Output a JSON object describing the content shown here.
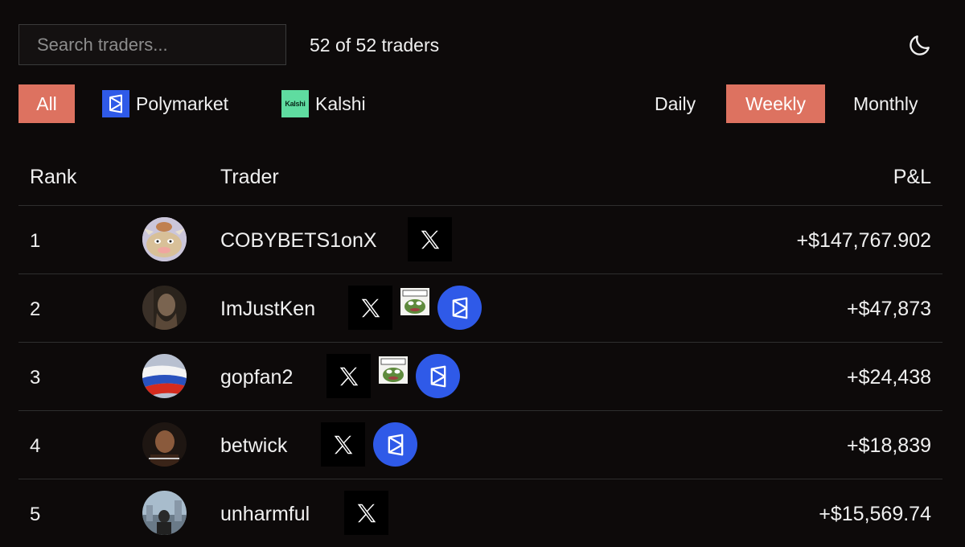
{
  "search": {
    "placeholder": "Search traders..."
  },
  "count_text": "52 of 52 traders",
  "platform_filters": {
    "all": "All",
    "polymarket": "Polymarket",
    "kalshi": "Kalshi",
    "kalshi_logo_text": "Kalshi"
  },
  "period_filters": {
    "daily": "Daily",
    "weekly": "Weekly",
    "monthly": "Monthly",
    "active": "Weekly"
  },
  "table": {
    "headers": {
      "rank": "Rank",
      "trader": "Trader",
      "pnl": "P&L"
    },
    "rows": [
      {
        "rank": "1",
        "name": "COBYBETS1onX",
        "pnl": "+$147,767.902",
        "badges": [
          "x-icon"
        ]
      },
      {
        "rank": "2",
        "name": "ImJustKen",
        "pnl": "+$47,873",
        "badges": [
          "x-icon",
          "pepe-icon",
          "polymarket-icon"
        ]
      },
      {
        "rank": "3",
        "name": "gopfan2",
        "pnl": "+$24,438",
        "badges": [
          "x-icon",
          "pepe-icon",
          "polymarket-icon"
        ]
      },
      {
        "rank": "4",
        "name": "betwick",
        "pnl": "+$18,839",
        "badges": [
          "x-icon",
          "polymarket-icon"
        ]
      },
      {
        "rank": "5",
        "name": "unharmful",
        "pnl": "+$15,569.74",
        "badges": [
          "x-icon"
        ]
      }
    ]
  },
  "colors": {
    "accent": "#dd7260",
    "polymarket": "#2f5ae8",
    "kalshi": "#5fdca0",
    "background": "#0d0a0a"
  },
  "icons": {
    "theme_toggle": "moon-icon"
  }
}
